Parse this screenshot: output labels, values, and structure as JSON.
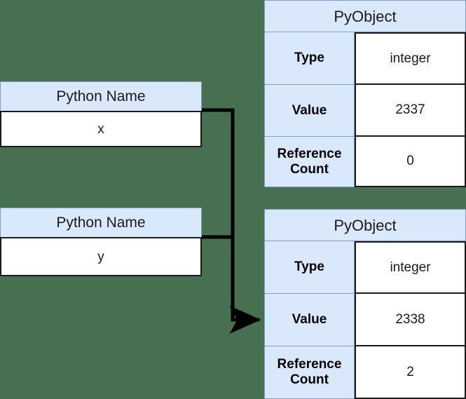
{
  "diagram": {
    "background_color": "#477050",
    "accent_color": "#dae8fc",
    "border_color": "#7b9bd1",
    "line_color": "#000000"
  },
  "names": [
    {
      "header": "Python Name",
      "value": "x"
    },
    {
      "header": "Python Name",
      "value": "y"
    }
  ],
  "objects": [
    {
      "title": "PyObject",
      "rows": [
        {
          "label": "Type",
          "value": "integer"
        },
        {
          "label": "Value",
          "value": "2337"
        },
        {
          "label": "Reference Count",
          "value": "0"
        }
      ]
    },
    {
      "title": "PyObject",
      "rows": [
        {
          "label": "Type",
          "value": "integer"
        },
        {
          "label": "Value",
          "value": "2338"
        },
        {
          "label": "Reference Count",
          "value": "2"
        }
      ]
    }
  ],
  "connectors": [
    {
      "from": "x",
      "to": "PyObject 2338"
    },
    {
      "from": "y",
      "to": "PyObject 2338"
    }
  ]
}
